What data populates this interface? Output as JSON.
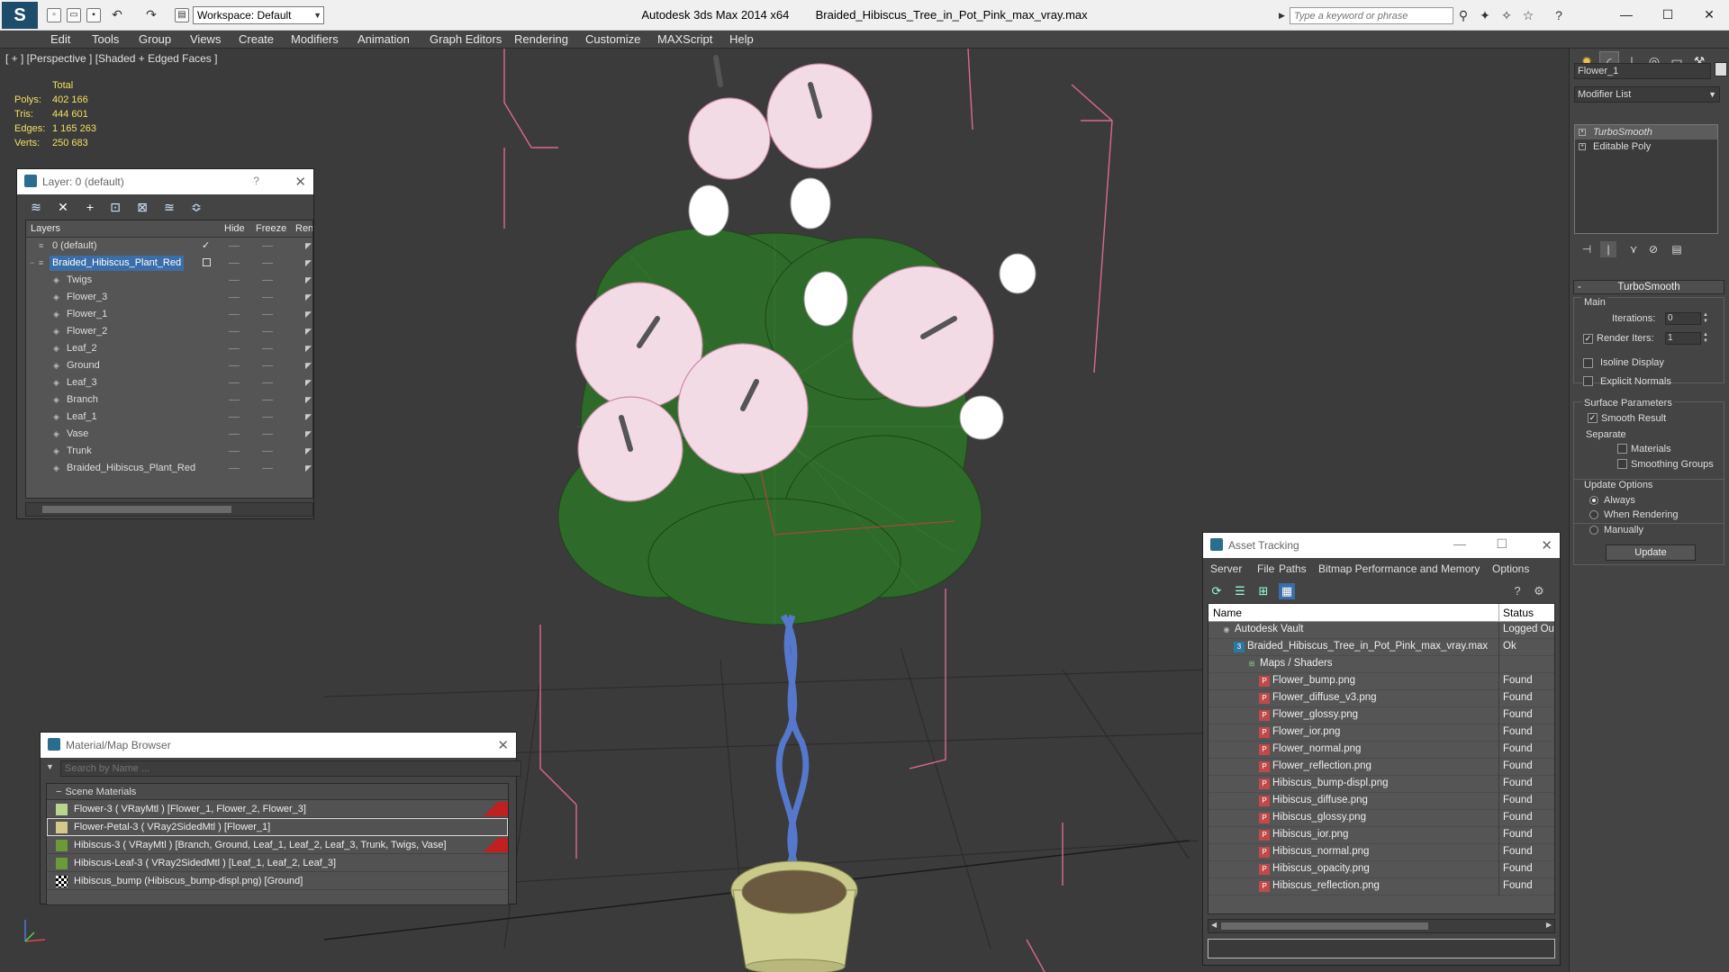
{
  "titlebar": {
    "workspace": "Workspace: Default",
    "app_name": "Autodesk 3ds Max  2014 x64",
    "file_name": "Braided_Hibiscus_Tree_in_Pot_Pink_max_vray.max",
    "search_placeholder": "Type a keyword or phrase",
    "minimize": "—",
    "maximize": "☐",
    "close": "✕"
  },
  "menu": [
    "Edit",
    "Tools",
    "Group",
    "Views",
    "Create",
    "Modifiers",
    "Animation",
    "Graph Editors",
    "Rendering",
    "Customize",
    "MAXScript",
    "Help"
  ],
  "viewport": {
    "label": "[ + ] [Perspective ] [Shaded + Edged Faces ]",
    "stats_header": "Total",
    "stats": [
      {
        "label": "Polys:",
        "value": "402 166"
      },
      {
        "label": "Tris:",
        "value": "444 601"
      },
      {
        "label": "Edges:",
        "value": "1 165 263"
      },
      {
        "label": "Verts:",
        "value": "250 683"
      }
    ]
  },
  "layer_panel": {
    "title": "Layer: 0 (default)",
    "help": "?",
    "close": "✕",
    "columns": [
      "Layers",
      "Hide",
      "Freeze",
      "Ren"
    ],
    "rows": [
      {
        "name": "0 (default)",
        "level": 0,
        "selected": false
      },
      {
        "name": "Braided_Hibiscus_Plant_Red",
        "level": 0,
        "selected": true
      },
      {
        "name": "Twigs",
        "level": 1,
        "selected": false
      },
      {
        "name": "Flower_3",
        "level": 1,
        "selected": false
      },
      {
        "name": "Flower_1",
        "level": 1,
        "selected": false
      },
      {
        "name": "Flower_2",
        "level": 1,
        "selected": false
      },
      {
        "name": "Leaf_2",
        "level": 1,
        "selected": false
      },
      {
        "name": "Ground",
        "level": 1,
        "selected": false
      },
      {
        "name": "Leaf_3",
        "level": 1,
        "selected": false
      },
      {
        "name": "Branch",
        "level": 1,
        "selected": false
      },
      {
        "name": "Leaf_1",
        "level": 1,
        "selected": false
      },
      {
        "name": "Vase",
        "level": 1,
        "selected": false
      },
      {
        "name": "Trunk",
        "level": 1,
        "selected": false
      },
      {
        "name": "Braided_Hibiscus_Plant_Red",
        "level": 1,
        "selected": false
      }
    ]
  },
  "material_browser": {
    "title": "Material/Map Browser",
    "close": "✕",
    "search_placeholder": "Search by Name ...",
    "group": "Scene Materials",
    "items": [
      {
        "text": "Flower-3  ( VRayMtl ) [Flower_1, Flower_2, Flower_3]",
        "flag": true,
        "highlight": false,
        "swatch": "#b8d690"
      },
      {
        "text": "Flower-Petal-3  ( VRay2SidedMtl ) [Flower_1]",
        "flag": false,
        "highlight": true,
        "swatch": "#d4c88a"
      },
      {
        "text": "Hibiscus-3  ( VRayMtl ) [Branch, Ground, Leaf_1, Leaf_2, Leaf_3, Trunk, Twigs, Vase]",
        "flag": true,
        "highlight": false,
        "swatch": "#6a9a3a"
      },
      {
        "text": "Hibiscus-Leaf-3  ( VRay2SidedMtl ) [Leaf_1, Leaf_2, Leaf_3]",
        "flag": false,
        "highlight": false,
        "swatch": "#6a9a3a"
      },
      {
        "text": "Hibiscus_bump (Hibiscus_bump-displ.png) [Ground]",
        "flag": false,
        "highlight": false,
        "swatch": "checker"
      }
    ]
  },
  "asset_tracking": {
    "title": "Asset Tracking",
    "menu": [
      "Server",
      "File",
      "Paths",
      "Bitmap Performance and Memory",
      "Options"
    ],
    "columns": [
      "Name",
      "Status"
    ],
    "rows": [
      {
        "name": "Autodesk Vault",
        "status": "Logged Ou",
        "indent": 1,
        "icon": "vault"
      },
      {
        "name": "Braided_Hibiscus_Tree_in_Pot_Pink_max_vray.max",
        "status": "Ok",
        "indent": 2,
        "icon": "max"
      },
      {
        "name": "Maps / Shaders",
        "status": "",
        "indent": 3,
        "icon": "folder"
      },
      {
        "name": "Flower_bump.png",
        "status": "Found",
        "indent": 4,
        "icon": "png"
      },
      {
        "name": "Flower_diffuse_v3.png",
        "status": "Found",
        "indent": 4,
        "icon": "png"
      },
      {
        "name": "Flower_glossy.png",
        "status": "Found",
        "indent": 4,
        "icon": "png"
      },
      {
        "name": "Flower_ior.png",
        "status": "Found",
        "indent": 4,
        "icon": "png"
      },
      {
        "name": "Flower_normal.png",
        "status": "Found",
        "indent": 4,
        "icon": "png"
      },
      {
        "name": "Flower_reflection.png",
        "status": "Found",
        "indent": 4,
        "icon": "png"
      },
      {
        "name": "Hibiscus_bump-displ.png",
        "status": "Found",
        "indent": 4,
        "icon": "png"
      },
      {
        "name": "Hibiscus_diffuse.png",
        "status": "Found",
        "indent": 4,
        "icon": "png"
      },
      {
        "name": "Hibiscus_glossy.png",
        "status": "Found",
        "indent": 4,
        "icon": "png"
      },
      {
        "name": "Hibiscus_ior.png",
        "status": "Found",
        "indent": 4,
        "icon": "png"
      },
      {
        "name": "Hibiscus_normal.png",
        "status": "Found",
        "indent": 4,
        "icon": "png"
      },
      {
        "name": "Hibiscus_opacity.png",
        "status": "Found",
        "indent": 4,
        "icon": "png"
      },
      {
        "name": "Hibiscus_reflection.png",
        "status": "Found",
        "indent": 4,
        "icon": "png"
      }
    ]
  },
  "command_panel": {
    "object_name": "Flower_1",
    "modifier_list": "Modifier List",
    "modifiers": [
      "TurboSmooth",
      "Editable Poly"
    ],
    "rollout_title": "TurboSmooth",
    "main_label": "Main",
    "iterations_label": "Iterations:",
    "iterations_value": "0",
    "render_iters_label": "Render Iters:",
    "render_iters_value": "1",
    "render_iters_checked": true,
    "isoline_label": "Isoline Display",
    "explicit_normals_label": "Explicit Normals",
    "surface_label": "Surface Parameters",
    "smooth_result_label": "Smooth Result",
    "smooth_result_checked": true,
    "separate_label": "Separate",
    "materials_label": "Materials",
    "smoothing_groups_label": "Smoothing Groups",
    "update_options_label": "Update Options",
    "always_label": "Always",
    "when_rendering_label": "When Rendering",
    "manually_label": "Manually",
    "update_option_selected": "Always",
    "update_button": "Update"
  },
  "colors": {
    "accent": "#3a6ea8",
    "stats_text": "#f2e060",
    "panel_bg": "#444444",
    "viewport_bg": "#3b3b3b",
    "bbox_pink": "#e05a8a"
  }
}
